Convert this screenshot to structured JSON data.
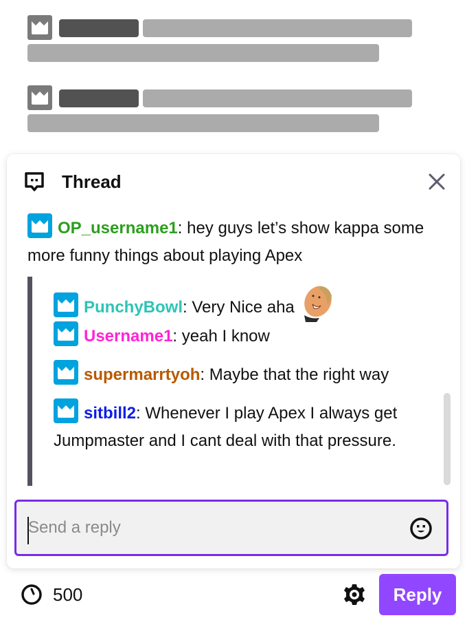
{
  "colors": {
    "accent": "#9147ff",
    "input_focus_border": "#772ce8",
    "badge": "#00a3de",
    "skeleton_dark": "#525252",
    "skeleton_light": "#ababab"
  },
  "background_chat": {
    "placeholder_rows": [
      {
        "badge_icon": "crown-icon"
      },
      {
        "badge_icon": "crown-icon"
      }
    ]
  },
  "thread": {
    "title": "Thread",
    "header_icon": "thread-bubble-icon",
    "close_icon": "close-icon",
    "original_message": {
      "username": "OP_username1",
      "username_color": "#2d9e1f",
      "separator": ": ",
      "text": "hey guys let’s show kappa some more funny things about playing Apex"
    },
    "replies": [
      {
        "username": "PunchyBowl",
        "username_color": "#2ec4b6",
        "separator": ": ",
        "text": "Very Nice aha",
        "emote": "face-emote"
      },
      {
        "username": "Username1",
        "username_color": "#ff24d4",
        "separator": ": ",
        "text": "yeah I know"
      },
      {
        "username": "supermarrtyoh",
        "username_color": "#b85a00",
        "separator": ": ",
        "text": "Maybe that the right way"
      },
      {
        "username": "sitbill2",
        "username_color": "#0d1de8",
        "separator": ": ",
        "text": "Whenever I play Apex I always get Jumpmaster and I cant deal with that pressure."
      }
    ],
    "input": {
      "placeholder": "Send a reply",
      "value": ""
    }
  },
  "footer": {
    "timer_value": "500",
    "reply_label": "Reply"
  }
}
